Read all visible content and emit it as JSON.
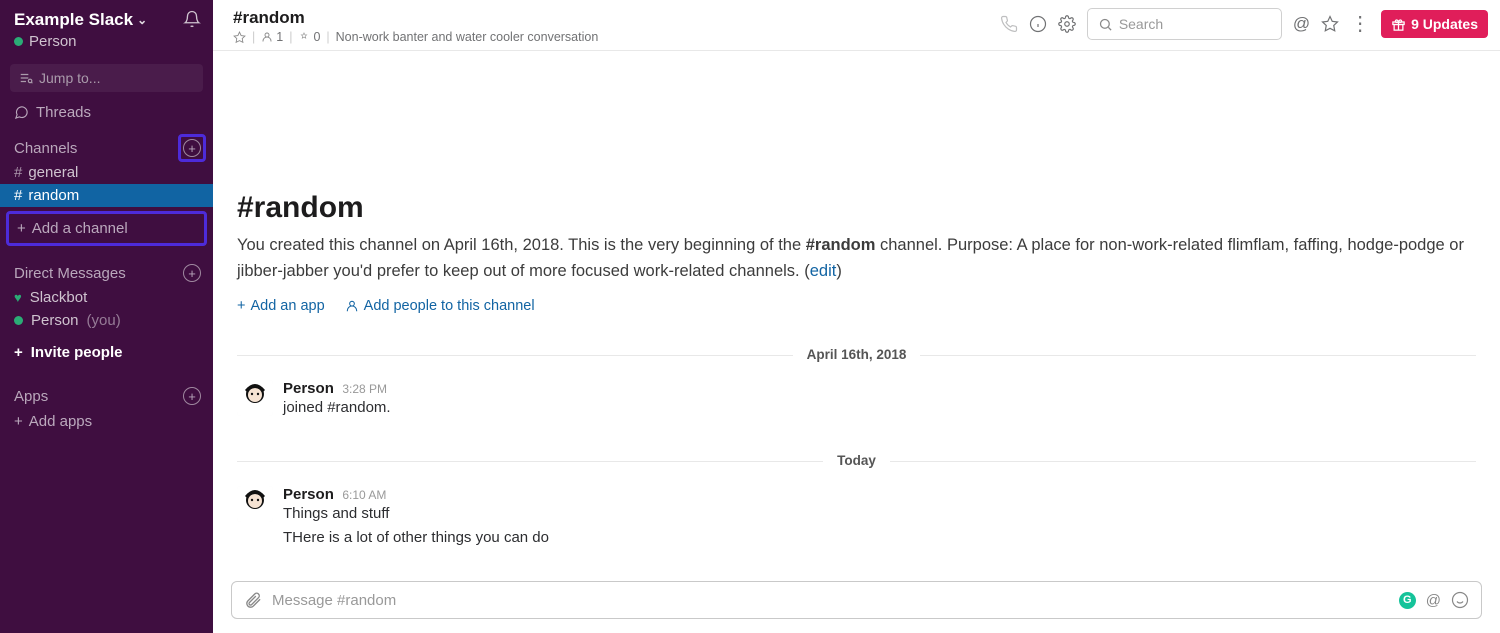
{
  "sidebar": {
    "team_name": "Example Slack",
    "user_name": "Person",
    "jump_to": "Jump to...",
    "threads": "Threads",
    "channels_header": "Channels",
    "channels": [
      {
        "name": "general",
        "active": false
      },
      {
        "name": "random",
        "active": true
      }
    ],
    "add_channel": "Add a channel",
    "dm_header": "Direct Messages",
    "dms": [
      {
        "name": "Slackbot",
        "you": false,
        "heart": true
      },
      {
        "name": "Person",
        "you": true,
        "heart": false
      }
    ],
    "you_label": "(you)",
    "invite": "Invite people",
    "apps_header": "Apps",
    "add_apps": "Add apps"
  },
  "header": {
    "channel": "#random",
    "members": "1",
    "pins": "0",
    "topic": "Non-work banter and water cooler conversation",
    "search_placeholder": "Search",
    "updates_count": "9 Updates"
  },
  "intro": {
    "title": "#random",
    "text_1": "You created this channel on April 16th, 2018. This is the very beginning of the ",
    "channel_name": "#random",
    "text_2": " channel. Purpose: A place for non-work-related flimflam, faffing, hodge-podge or jibber-jabber you'd prefer to keep out of more focused work-related channels. (",
    "edit": "edit",
    "text_3": ")",
    "add_app": "Add an app",
    "add_people": "Add people to this channel"
  },
  "dividers": {
    "d1": "April 16th, 2018",
    "d2": "Today"
  },
  "messages": {
    "m1_name": "Person",
    "m1_time": "3:28 PM",
    "m1_text": "joined #random.",
    "m2_name": "Person",
    "m2_time": "6:10 AM",
    "m2_text": "Things and stuff",
    "m2_text2": "THere is a lot of other things you can do"
  },
  "composer": {
    "placeholder": "Message #random"
  }
}
